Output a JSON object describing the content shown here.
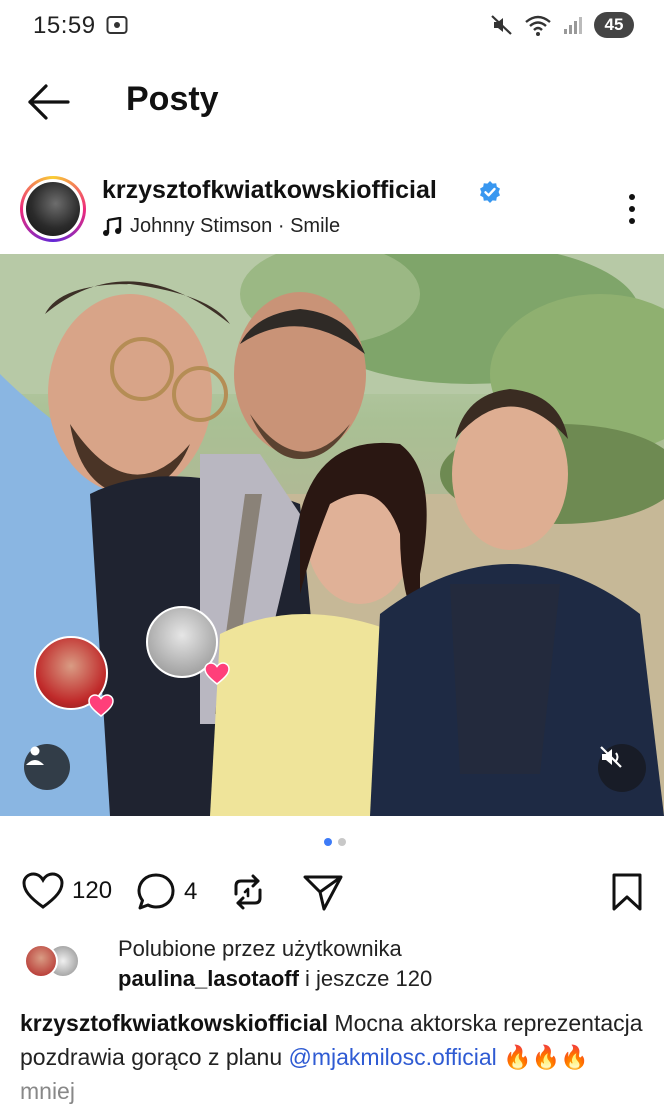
{
  "status_bar": {
    "time": "15:59",
    "battery": "45",
    "icons": [
      "screen-record-icon",
      "mute-icon",
      "wifi-icon",
      "signal-icon"
    ]
  },
  "header": {
    "title": "Posty",
    "back_icon": "arrow-left-icon"
  },
  "post": {
    "username": "krzysztofkwiatkowskiofficial",
    "verified": true,
    "music": {
      "artist": "Johnny Stimson",
      "separator": " · ",
      "track": "Smile"
    },
    "likes_count": "120",
    "comments_count": "4",
    "carousel": {
      "total": 2,
      "current": 1
    },
    "liked_by": {
      "prefix": "Polubione przez użytkownika",
      "user": "paulina_lasotaoff",
      "suffix": " i jeszcze 120"
    },
    "caption": {
      "username": "krzysztofkwiatkowskiofficial",
      "text": " Mocna aktorska reprezentacja pozdrawia gorąco z planu ",
      "mention": "@mjakmilosc.official",
      "emojis": "🔥🔥🔥",
      "more": "mniej"
    }
  },
  "colors": {
    "verified_blue": "#3897f0",
    "mention_blue": "#2f5bd3",
    "dot_active": "#3d7bf7",
    "heart_pink": "#ff3f7a"
  }
}
